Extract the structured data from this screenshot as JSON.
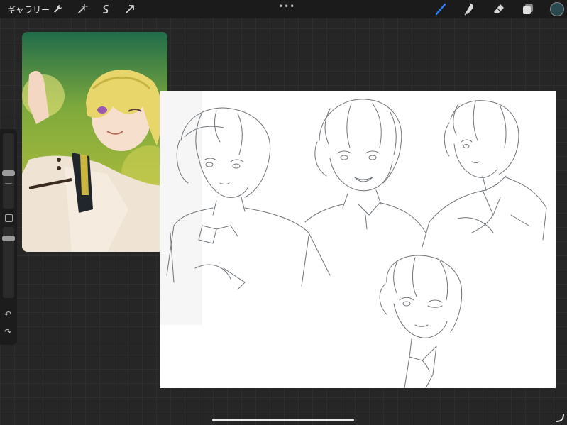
{
  "topbar": {
    "gallery_label": "ギャラリー",
    "left_tools": [
      {
        "name": "actions-wrench-icon"
      },
      {
        "name": "adjustments-wand-icon"
      },
      {
        "name": "selection-icon"
      },
      {
        "name": "transform-arrow-icon"
      }
    ],
    "more_dots": "•••",
    "right_tools": [
      {
        "name": "brush-icon",
        "active": true,
        "color": "#2f7fff"
      },
      {
        "name": "smudge-icon",
        "active": false
      },
      {
        "name": "eraser-icon",
        "active": false
      },
      {
        "name": "layers-icon",
        "active": false
      }
    ],
    "current_color": "#2a4a52"
  },
  "sidebar": {
    "undo_icon": "↶",
    "redo_icon": "↷"
  },
  "reference": {
    "description_icon": "reference-image"
  },
  "colors": {
    "background": "#262626",
    "topbar": "#1b1b1b",
    "canvas": "#ffffff",
    "sketch_stroke": "#6f7479",
    "accent": "#2f7fff"
  }
}
